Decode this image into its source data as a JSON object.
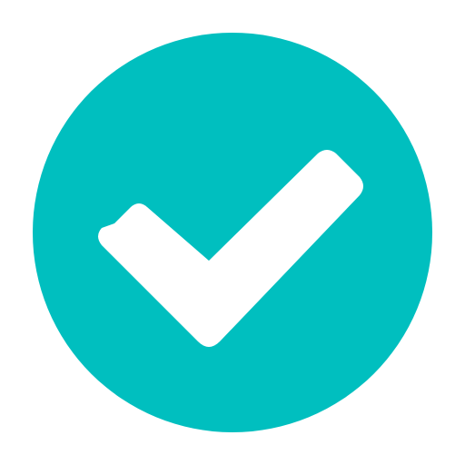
{
  "icon": {
    "name": "check-circle-icon",
    "circle_color": "#00BFBF",
    "check_color": "#FFFFFF",
    "background_color": "#FFFFFF"
  }
}
